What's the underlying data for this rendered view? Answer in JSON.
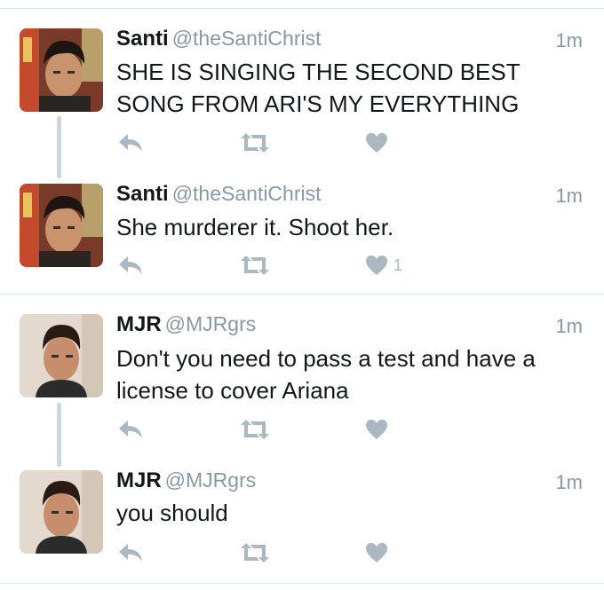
{
  "colors": {
    "icon": "#aab8c2",
    "muted": "#8899a6",
    "separator": "#e1e8ed",
    "thread_line": "#ccd6dd"
  },
  "tweets": [
    {
      "name": "Santi",
      "handle": "@theSantiChrist",
      "time": "1m",
      "lines": [
        "SHE IS SINGING THE SECOND BEST",
        "SONG FROM ARI'S MY EVERYTHING"
      ],
      "likes": ""
    },
    {
      "name": "Santi",
      "handle": "@theSantiChrist",
      "time": "1m",
      "lines": [
        "She murderer it. Shoot her."
      ],
      "likes": "1"
    },
    {
      "name": "MJR",
      "handle": "@MJRgrs",
      "time": "1m",
      "lines": [
        "Don't you need to pass a test and have a",
        "license to cover Ariana"
      ],
      "likes": ""
    },
    {
      "name": "MJR",
      "handle": "@MJRgrs",
      "time": "1m",
      "lines": [
        "you should"
      ],
      "likes": ""
    }
  ],
  "icons": {
    "reply": "reply-icon",
    "retweet": "retweet-icon",
    "like": "heart-icon"
  }
}
